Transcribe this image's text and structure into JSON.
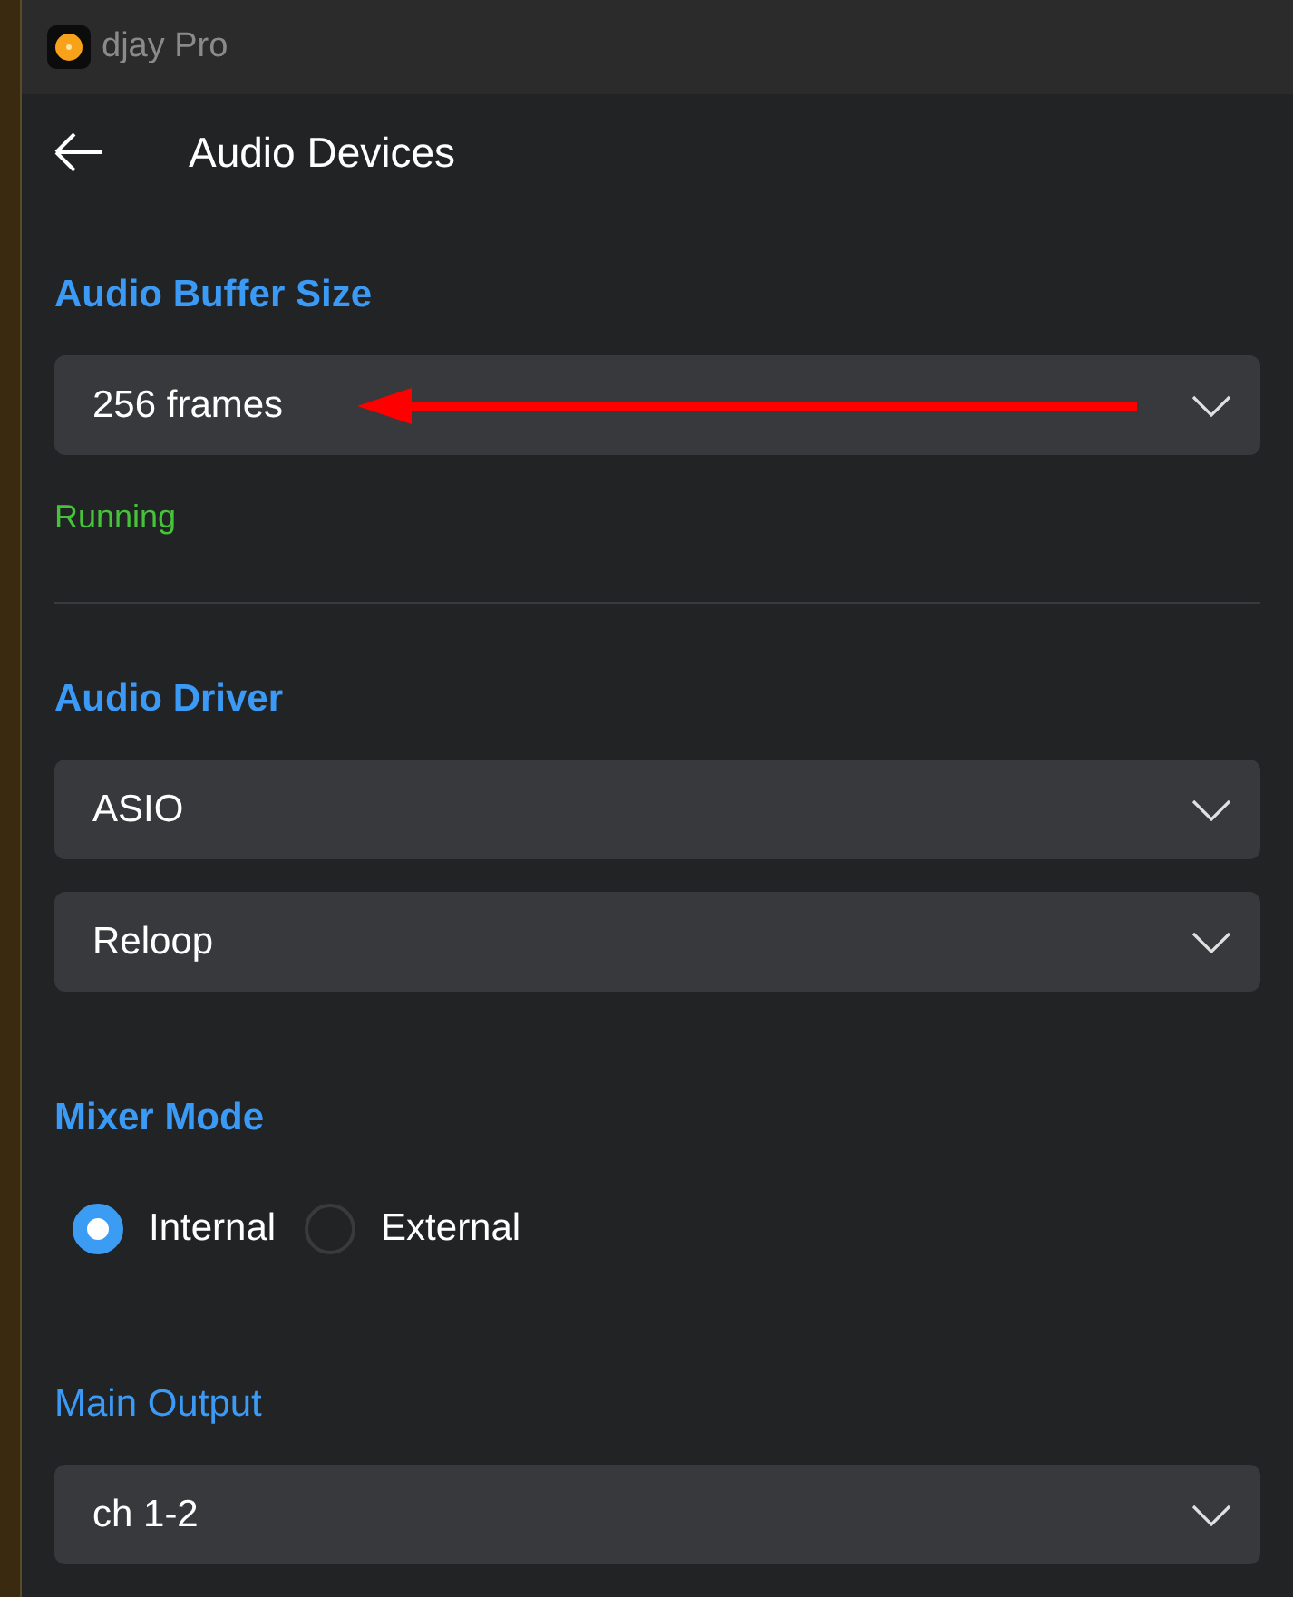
{
  "window": {
    "title": "djay Pro"
  },
  "page": {
    "title": "Audio Devices"
  },
  "content": [
    {
      "kind": "heading",
      "text": "Audio Buffer Size",
      "bold": true
    },
    {
      "kind": "dropdown",
      "value": "256 frames",
      "annotation": {
        "kind": "arrow"
      }
    },
    {
      "kind": "status",
      "text": "Running"
    },
    {
      "kind": "divider"
    },
    {
      "kind": "heading",
      "text": "Audio Driver",
      "bold": true
    },
    {
      "kind": "dropdown",
      "value": "ASIO"
    },
    {
      "kind": "dropdown",
      "value": "Reloop"
    },
    {
      "kind": "heading",
      "text": "Mixer Mode",
      "bold": true
    },
    {
      "kind": "radios",
      "options": [
        {
          "label": "Internal",
          "selected": true
        },
        {
          "label": "External",
          "selected": false
        }
      ]
    },
    {
      "kind": "heading",
      "text": "Main Output",
      "bold": false
    },
    {
      "kind": "dropdown",
      "value": "ch 1-2"
    }
  ]
}
